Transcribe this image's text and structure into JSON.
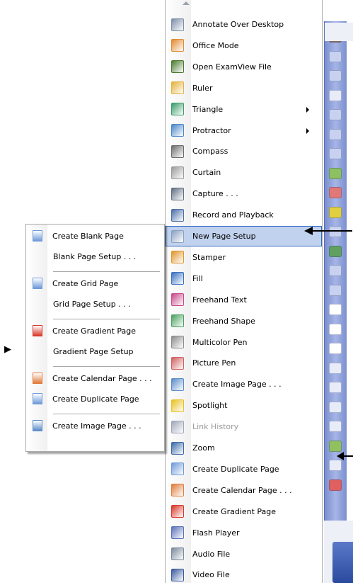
{
  "main_menu": {
    "items": [
      {
        "label": "Annotate Over Desktop",
        "icon": "annotate-desktop-icon",
        "color": "#7d8ea8"
      },
      {
        "label": "Office Mode",
        "icon": "office-mode-icon",
        "color": "#e08a2e"
      },
      {
        "label": "Open ExamView File",
        "icon": "examview-icon",
        "color": "#4a7a2e"
      },
      {
        "label": "Ruler",
        "icon": "ruler-icon",
        "color": "#e3b23c"
      },
      {
        "label": "Triangle",
        "icon": "triangle-icon",
        "color": "#3a9c6a",
        "submenu": true
      },
      {
        "label": "Protractor",
        "icon": "protractor-icon",
        "color": "#4a86c8",
        "submenu": true
      },
      {
        "label": "Compass",
        "icon": "compass-icon",
        "color": "#6c6c6c"
      },
      {
        "label": "Curtain",
        "icon": "curtain-icon",
        "color": "#9a9a9a"
      },
      {
        "label": "Capture . . .",
        "icon": "camera-icon",
        "color": "#5f6f80"
      },
      {
        "label": "Record and Playback",
        "icon": "record-icon",
        "color": "#4b6fa8"
      },
      {
        "label": "New Page Setup",
        "icon": "new-page-setup-icon",
        "color": "#8aa0c0",
        "highlight": true
      },
      {
        "label": "Stamper",
        "icon": "stamper-icon",
        "color": "#e0962c"
      },
      {
        "label": "Fill",
        "icon": "fill-icon",
        "color": "#3a72c0"
      },
      {
        "label": "Freehand Text",
        "icon": "freehand-text-icon",
        "color": "#c84a8a"
      },
      {
        "label": "Freehand Shape",
        "icon": "freehand-shape-icon",
        "color": "#4aa060"
      },
      {
        "label": "Multicolor Pen",
        "icon": "multicolor-pen-icon",
        "color": "#8c8c8c"
      },
      {
        "label": "Picture Pen",
        "icon": "picture-pen-icon",
        "color": "#d06060"
      },
      {
        "label": "Create Image Page . . .",
        "icon": "image-page-icon",
        "color": "#5a8cc8"
      },
      {
        "label": "Spotlight",
        "icon": "spotlight-icon",
        "color": "#e8c020"
      },
      {
        "label": "Link History",
        "icon": "link-history-icon",
        "color": "#a0a8b8",
        "disabled": true
      },
      {
        "label": "Zoom",
        "icon": "zoom-icon",
        "color": "#3c6aa8"
      },
      {
        "label": "Create Duplicate Page",
        "icon": "duplicate-page-icon",
        "color": "#6f9ad8"
      },
      {
        "label": "Create Calendar Page . . .",
        "icon": "calendar-page-icon",
        "color": "#e07c3c"
      },
      {
        "label": "Create Gradient Page",
        "icon": "gradient-page-icon",
        "color": "#d8382a"
      },
      {
        "label": "Flash Player",
        "icon": "flash-player-icon",
        "color": "#5a72b8"
      },
      {
        "label": "Audio File",
        "icon": "audio-file-icon",
        "color": "#7a8a9a"
      },
      {
        "label": "Video File",
        "icon": "video-file-icon",
        "color": "#3a5aa0"
      }
    ]
  },
  "sub_menu": {
    "items": [
      {
        "label": "Create Blank Page",
        "icon": "blank-page-icon",
        "color": "#6f9ad8"
      },
      {
        "label": "Blank Page Setup . . .",
        "indent": true
      },
      {
        "separator": true
      },
      {
        "label": "Create Grid Page",
        "icon": "grid-page-icon",
        "color": "#6f9ad8"
      },
      {
        "label": "Grid Page Setup . . .",
        "indent": true
      },
      {
        "separator": true
      },
      {
        "label": "Create Gradient Page",
        "icon": "gradient-page-icon",
        "color": "#d8382a"
      },
      {
        "label": "Gradient Page Setup",
        "indent": true
      },
      {
        "separator": true
      },
      {
        "label": "Create Calendar Page . . .",
        "icon": "calendar-page-icon",
        "color": "#e07c3c"
      },
      {
        "label": "Create Duplicate Page",
        "icon": "duplicate-page-icon",
        "color": "#6f9ad8"
      },
      {
        "separator": true
      },
      {
        "label": "Create Image Page . . .",
        "icon": "image-page-icon",
        "color": "#5a8cc8"
      }
    ]
  },
  "toolbar": {
    "buttons": [
      {
        "icon": "trash-icon",
        "color": "#8c6a5a"
      },
      {
        "icon": "minus-circle-icon",
        "color": "#c8d2f0"
      },
      {
        "icon": "down-circle-icon",
        "color": "#c8d2f0"
      },
      {
        "icon": "mouse-icon",
        "color": "#e8ecf8"
      },
      {
        "icon": "select-icon",
        "color": "#c8d2f0"
      },
      {
        "icon": "pointer-icon",
        "color": "#c8d2f0"
      },
      {
        "icon": "pointer-box-icon",
        "color": "#c8d2f0"
      },
      {
        "icon": "pen-icon",
        "color": "#8cc060"
      },
      {
        "icon": "eraser-icon",
        "color": "#e07878"
      },
      {
        "icon": "highlighter-icon",
        "color": "#e0d040"
      },
      {
        "icon": "shape-icon",
        "color": "#c8d2f0"
      },
      {
        "icon": "table-icon",
        "color": "#60a060"
      },
      {
        "icon": "undo-icon",
        "color": "#c8d2f0"
      },
      {
        "icon": "delete-icon",
        "color": "#c8d2f0"
      },
      {
        "icon": "page-icon",
        "color": "#ffffff"
      },
      {
        "icon": "page-lines-icon",
        "color": "#ffffff"
      },
      {
        "icon": "pages-icon",
        "color": "#ffffff"
      },
      {
        "icon": "back-icon",
        "color": "#e8ecf8"
      },
      {
        "icon": "forward-icon",
        "color": "#e8ecf8"
      },
      {
        "icon": "keyboard-icon",
        "color": "#e8ecf8"
      },
      {
        "icon": "save-icon",
        "color": "#e8ecf8"
      },
      {
        "icon": "image-icon",
        "color": "#90c060"
      },
      {
        "icon": "tools-icon",
        "color": "#e8ecf8"
      },
      {
        "icon": "close-circle-icon",
        "color": "#e06060"
      }
    ]
  }
}
